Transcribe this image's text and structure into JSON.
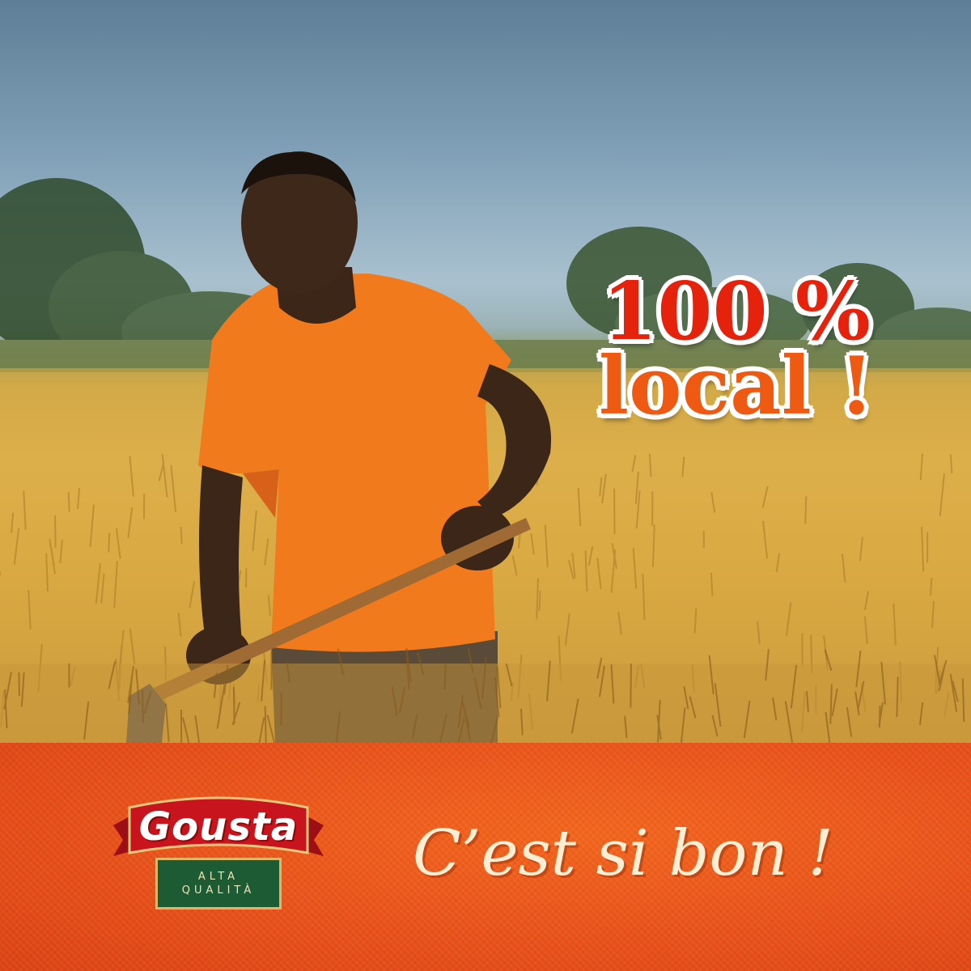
{
  "headline": {
    "line1": "100 %",
    "line2": "local !"
  },
  "brand": {
    "name": "Gousta",
    "tagline_line1": "ALTA",
    "tagline_line2": "QUALITÀ"
  },
  "slogan": "C’est si bon !",
  "colors": {
    "headline_red": "#e5230d",
    "headline_orange": "#ee5a12",
    "banner_orange": "#e8501a",
    "logo_red": "#c8141c",
    "logo_green": "#1d5b34",
    "slogan_cream": "#fbeed3"
  },
  "scene": {
    "subject": "farmer",
    "shirt_color": "#f07a1c"
  }
}
